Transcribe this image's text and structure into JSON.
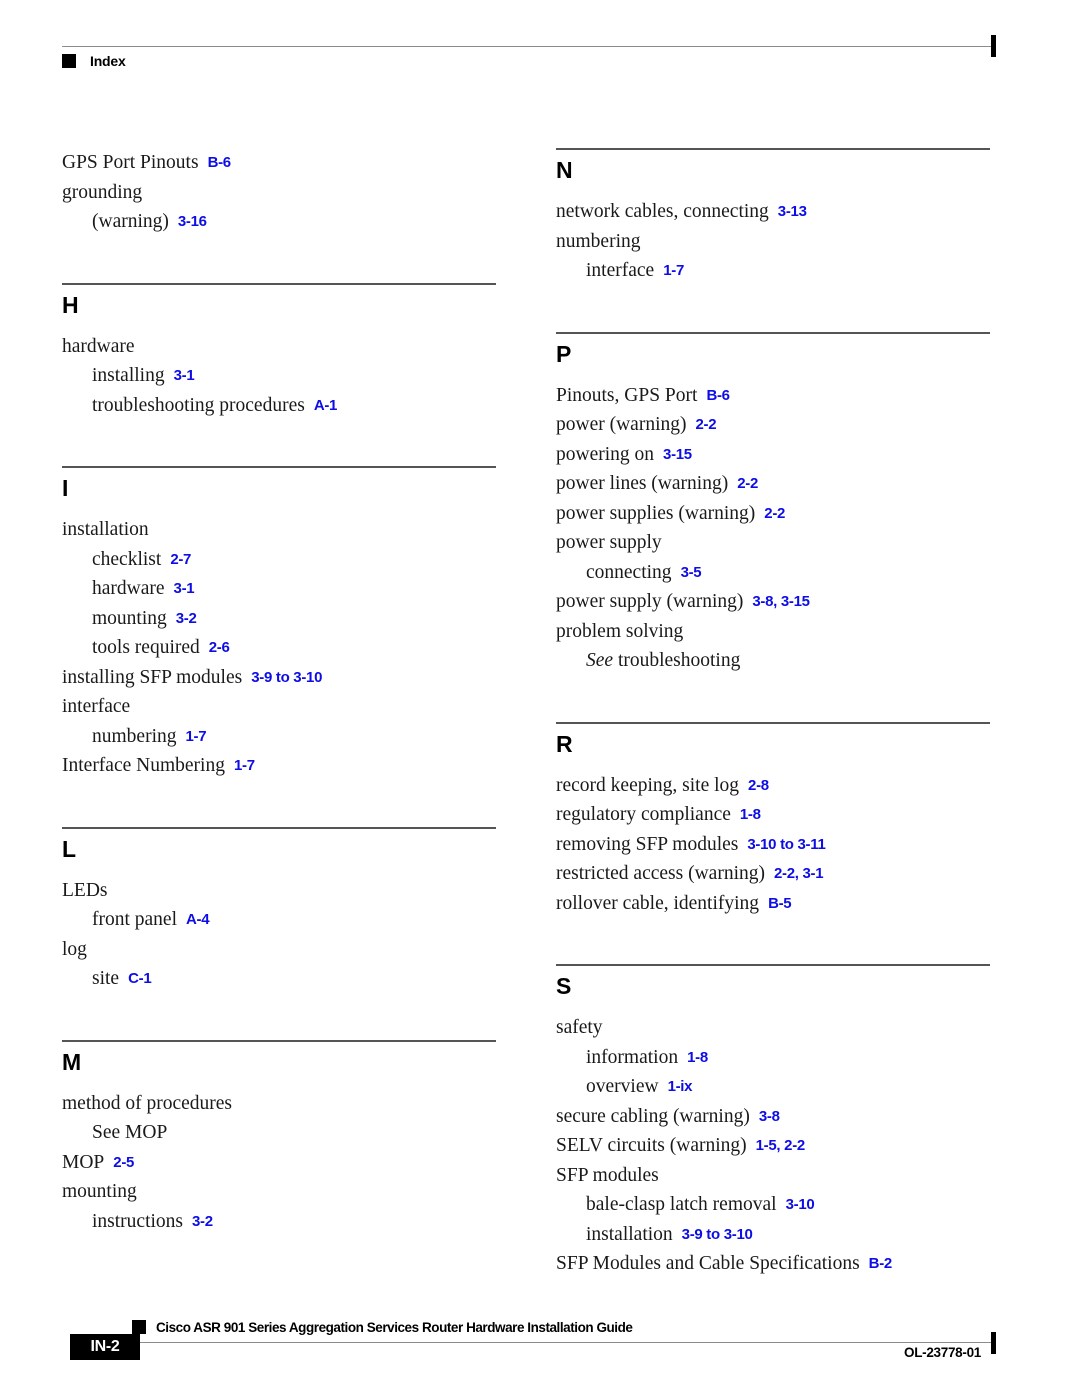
{
  "header": {
    "label": "Index"
  },
  "columns": {
    "left": [
      {
        "letter": "",
        "has_rule": false,
        "entries": [
          {
            "level": 1,
            "text": "GPS Port Pinouts",
            "ref": "B-6"
          },
          {
            "level": 1,
            "text": "grounding",
            "ref": ""
          },
          {
            "level": 2,
            "text": "(warning)",
            "ref": "3-16"
          }
        ]
      },
      {
        "letter": "H",
        "has_rule": true,
        "entries": [
          {
            "level": 1,
            "text": "hardware",
            "ref": ""
          },
          {
            "level": 2,
            "text": "installing",
            "ref": "3-1"
          },
          {
            "level": 2,
            "text": "troubleshooting procedures",
            "ref": "A-1"
          }
        ]
      },
      {
        "letter": "I",
        "has_rule": true,
        "entries": [
          {
            "level": 1,
            "text": "installation",
            "ref": ""
          },
          {
            "level": 2,
            "text": "checklist",
            "ref": "2-7"
          },
          {
            "level": 2,
            "text": "hardware",
            "ref": "3-1"
          },
          {
            "level": 2,
            "text": "mounting",
            "ref": "3-2"
          },
          {
            "level": 2,
            "text": "tools required",
            "ref": "2-6"
          },
          {
            "level": 1,
            "text": "installing SFP modules",
            "ref": "3-9 to 3-10"
          },
          {
            "level": 1,
            "text": "interface",
            "ref": ""
          },
          {
            "level": 2,
            "text": "numbering",
            "ref": "1-7"
          },
          {
            "level": 1,
            "text": "Interface Numbering",
            "ref": "1-7"
          }
        ]
      },
      {
        "letter": "L",
        "has_rule": true,
        "entries": [
          {
            "level": 1,
            "text": "LEDs",
            "ref": ""
          },
          {
            "level": 2,
            "text": "front panel",
            "ref": "A-4"
          },
          {
            "level": 1,
            "text": "log",
            "ref": ""
          },
          {
            "level": 2,
            "text": "site",
            "ref": "C-1"
          }
        ]
      },
      {
        "letter": "M",
        "has_rule": true,
        "entries": [
          {
            "level": 1,
            "text": "method of procedures",
            "ref": ""
          },
          {
            "level": 2,
            "text": "See MOP",
            "ref": ""
          },
          {
            "level": 1,
            "text": "MOP",
            "ref": "2-5"
          },
          {
            "level": 1,
            "text": "mounting",
            "ref": ""
          },
          {
            "level": 2,
            "text": "instructions",
            "ref": "3-2"
          }
        ]
      }
    ],
    "right": [
      {
        "letter": "N",
        "has_rule": true,
        "entries": [
          {
            "level": 1,
            "text": "network cables, connecting",
            "ref": "3-13"
          },
          {
            "level": 1,
            "text": "numbering",
            "ref": ""
          },
          {
            "level": 2,
            "text": "interface",
            "ref": "1-7"
          }
        ]
      },
      {
        "letter": "P",
        "has_rule": true,
        "entries": [
          {
            "level": 1,
            "text": "Pinouts, GPS Port",
            "ref": "B-6"
          },
          {
            "level": 1,
            "text": "power (warning)",
            "ref": "2-2"
          },
          {
            "level": 1,
            "text": "powering on",
            "ref": "3-15"
          },
          {
            "level": 1,
            "text": "power lines (warning)",
            "ref": "2-2"
          },
          {
            "level": 1,
            "text": "power supplies (warning)",
            "ref": "2-2"
          },
          {
            "level": 1,
            "text": "power supply",
            "ref": ""
          },
          {
            "level": 2,
            "text": "connecting",
            "ref": "3-5"
          },
          {
            "level": 1,
            "text": "power supply (warning)",
            "ref": "3-8, 3-15"
          },
          {
            "level": 1,
            "text": "problem solving",
            "ref": ""
          },
          {
            "level": 2,
            "text": "See troubleshooting",
            "ref": "",
            "italic_prefix": "See",
            "italic_rest": " troubleshooting"
          }
        ]
      },
      {
        "letter": "R",
        "has_rule": true,
        "entries": [
          {
            "level": 1,
            "text": "record keeping, site log",
            "ref": "2-8"
          },
          {
            "level": 1,
            "text": "regulatory compliance",
            "ref": "1-8"
          },
          {
            "level": 1,
            "text": "removing SFP modules",
            "ref": "3-10 to 3-11"
          },
          {
            "level": 1,
            "text": "restricted access (warning)",
            "ref": "2-2, 3-1"
          },
          {
            "level": 1,
            "text": "rollover cable, identifying",
            "ref": "B-5"
          }
        ]
      },
      {
        "letter": "S",
        "has_rule": true,
        "entries": [
          {
            "level": 1,
            "text": "safety",
            "ref": ""
          },
          {
            "level": 2,
            "text": "information",
            "ref": "1-8"
          },
          {
            "level": 2,
            "text": "overview",
            "ref": "1-ix"
          },
          {
            "level": 1,
            "text": "secure cabling (warning)",
            "ref": "3-8"
          },
          {
            "level": 1,
            "text": "SELV circuits (warning)",
            "ref": "1-5, 2-2"
          },
          {
            "level": 1,
            "text": "SFP modules",
            "ref": ""
          },
          {
            "level": 2,
            "text": "bale-clasp latch removal",
            "ref": "3-10"
          },
          {
            "level": 2,
            "text": "installation",
            "ref": "3-9 to 3-10"
          },
          {
            "level": 1,
            "text": "SFP Modules and Cable Specifications",
            "ref": "B-2"
          }
        ]
      }
    ]
  },
  "footer": {
    "page_number": "IN-2",
    "doc_title": "Cisco ASR 901 Series Aggregation Services Router Hardware Installation Guide",
    "doc_number": "OL-23778-01"
  },
  "colors": {
    "reference_blue": "#0d0de6",
    "rule_gray": "#8c8c8c",
    "section_rule": "#555555"
  }
}
